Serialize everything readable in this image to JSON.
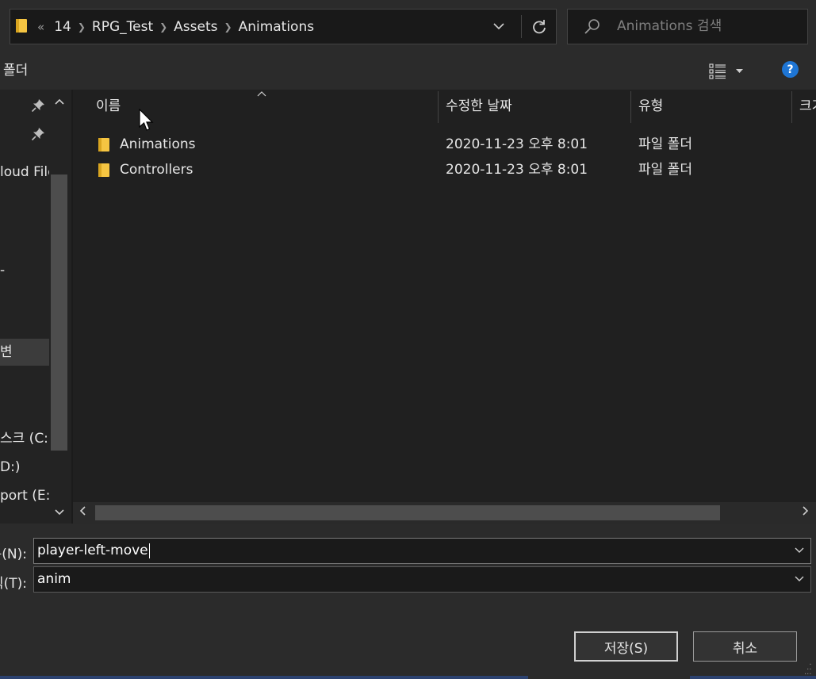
{
  "address_bar": {
    "overflow": "«",
    "crumbs": [
      "14",
      "RPG_Test",
      "Assets",
      "Animations"
    ]
  },
  "search": {
    "placeholder": "Animations 검색"
  },
  "toolbar": {
    "new_folder": "폴더",
    "help": "?"
  },
  "nav": {
    "items": [
      {
        "label": "loud File"
      },
      {
        "label": "-"
      },
      {
        "label": "변"
      },
      {
        "label": "스크 (C:)"
      },
      {
        "label": "D:)"
      },
      {
        "label": "port (E:)"
      }
    ]
  },
  "file_list": {
    "columns": {
      "name": "이름",
      "modified": "수정한 날짜",
      "type": "유형",
      "size": "크기"
    },
    "rows": [
      {
        "name": "Animations",
        "modified": "2020-11-23 오후 8:01",
        "type": "파일 폴더"
      },
      {
        "name": "Controllers",
        "modified": "2020-11-23 오후 8:01",
        "type": "파일 폴더"
      }
    ]
  },
  "form": {
    "filename_label": "름(N):",
    "filename_value": "player-left-move",
    "filetype_label": "식(T):",
    "filetype_value": "anim",
    "save_label": "저장(S)",
    "cancel_label": "취소"
  },
  "colors": {
    "window_bg": "#2b2b2b",
    "list_bg": "#202020",
    "accent_help": "#1e75d4",
    "folder_yellow": "#f5c542"
  }
}
